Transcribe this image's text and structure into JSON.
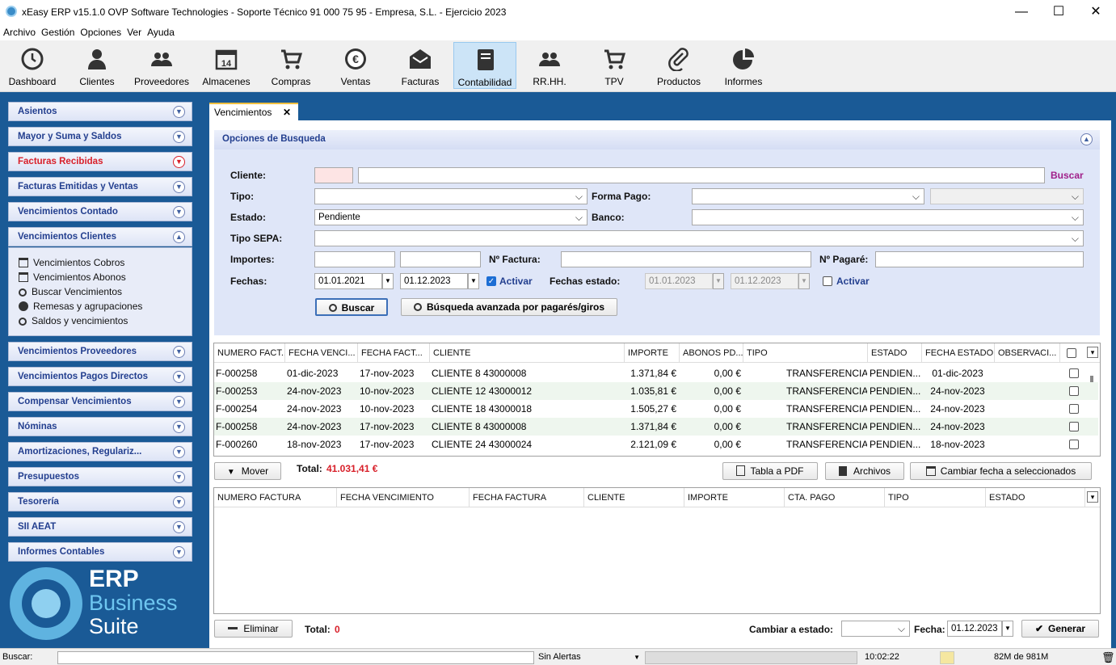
{
  "window": {
    "title": "xEasy ERP v15.1.0 OVP Software Technologies - Soporte Técnico 91 000 75 95 - Empresa, S.L. - Ejercicio 2023",
    "minimize": "—",
    "maximize": "☐",
    "close": "✕"
  },
  "menu": [
    "Archivo",
    "Gestión",
    "Opciones",
    "Ver",
    "Ayuda"
  ],
  "toolbar": [
    {
      "label": "Dashboard",
      "icon": "clock-icon"
    },
    {
      "label": "Clientes",
      "icon": "person-icon"
    },
    {
      "label": "Proveedores",
      "icon": "group-icon"
    },
    {
      "label": "Almacenes",
      "icon": "calendar-icon"
    },
    {
      "label": "Compras",
      "icon": "cart-icon"
    },
    {
      "label": "Ventas",
      "icon": "euro-icon"
    },
    {
      "label": "Facturas",
      "icon": "envelope-icon"
    },
    {
      "label": "Contabilidad",
      "icon": "book-icon",
      "active": true
    },
    {
      "label": "RR.HH.",
      "icon": "group-icon"
    },
    {
      "label": "TPV",
      "icon": "cart-icon"
    },
    {
      "label": "Productos",
      "icon": "paperclip-icon"
    },
    {
      "label": "Informes",
      "icon": "piechart-icon"
    }
  ],
  "sidebar": {
    "sections": [
      "Asientos",
      "Mayor y Suma y Saldos",
      "Facturas Recibidas",
      "Facturas Emitidas y Ventas",
      "Vencimientos Contado",
      "Vencimientos Clientes",
      "Vencimientos Proveedores",
      "Vencimientos Pagos Directos",
      "Compensar Vencimientos",
      "Nóminas",
      "Amortizaciones, Regulariz...",
      "Presupuestos",
      "Tesorería",
      "SII AEAT",
      "Informes Contables"
    ],
    "subitems": [
      "Vencimientos Cobros",
      "Vencimientos Abonos",
      "Buscar Vencimientos",
      "Remesas y agrupaciones",
      "Saldos y vencimientos"
    ],
    "logo": {
      "l1": "ERP",
      "l2": "Business",
      "l3": "Suite"
    }
  },
  "tab": {
    "label": "Vencimientos",
    "close": "✕"
  },
  "search": {
    "header": "Opciones de Busqueda",
    "cliente_label": "Cliente:",
    "buscar_link": "Buscar",
    "tipo_label": "Tipo:",
    "forma_pago_label": "Forma Pago:",
    "estado_label": "Estado:",
    "estado_value": "Pendiente",
    "banco_label": "Banco:",
    "tipo_sepa_label": "Tipo SEPA:",
    "importes_label": "Importes:",
    "nfactura_label": "Nº Factura:",
    "npagare_label": "Nº Pagaré:",
    "fechas_label": "Fechas:",
    "fecha_desde": "01.01.2021",
    "fecha_hasta": "01.12.2023",
    "activar": "Activar",
    "fechas_estado_label": "Fechas estado:",
    "fe_desde": "01.01.2023",
    "fe_hasta": "01.12.2023",
    "activar2": "Activar",
    "buscar_btn": "Buscar",
    "avanzada_btn": "Búsqueda avanzada por pagarés/giros"
  },
  "grid1": {
    "headers": [
      "NUMERO FACT...",
      "FECHA VENCI...",
      "FECHA FACT...",
      "CLIENTE",
      "IMPORTE",
      "ABONOS PD...",
      "TIPO",
      "ESTADO",
      "FECHA ESTADO",
      "OBSERVACI..."
    ],
    "rows": [
      [
        "F-000258",
        "01-dic-2023",
        "17-nov-2023",
        "CLIENTE 8 43000008",
        "1.371,84 €",
        "0,00 €",
        "TRANSFERENCIA",
        "PENDIEN...",
        "01-dic-2023"
      ],
      [
        "F-000253",
        "24-nov-2023",
        "10-nov-2023",
        "CLIENTE 12 43000012",
        "1.035,81 €",
        "0,00 €",
        "TRANSFERENCIA",
        "PENDIEN...",
        "24-nov-2023"
      ],
      [
        "F-000254",
        "24-nov-2023",
        "10-nov-2023",
        "CLIENTE 18 43000018",
        "1.505,27 €",
        "0,00 €",
        "TRANSFERENCIA",
        "PENDIEN...",
        "24-nov-2023"
      ],
      [
        "F-000258",
        "24-nov-2023",
        "17-nov-2023",
        "CLIENTE 8 43000008",
        "1.371,84 €",
        "0,00 €",
        "TRANSFERENCIA",
        "PENDIEN...",
        "24-nov-2023"
      ],
      [
        "F-000260",
        "18-nov-2023",
        "17-nov-2023",
        "CLIENTE 24 43000024",
        "2.121,09 €",
        "0,00 €",
        "TRANSFERENCIA",
        "PENDIEN...",
        "18-nov-2023"
      ]
    ]
  },
  "actions1": {
    "mover": "Mover",
    "total_label": "Total:",
    "total_value": "41.031,41 €",
    "pdf": "Tabla a PDF",
    "archivos": "Archivos",
    "cambiar_fecha": "Cambiar fecha a seleccionados"
  },
  "grid2": {
    "headers": [
      "NUMERO FACTURA",
      "FECHA VENCIMIENTO",
      "FECHA FACTURA",
      "CLIENTE",
      "IMPORTE",
      "CTA. PAGO",
      "TIPO",
      "ESTADO"
    ]
  },
  "actions2": {
    "eliminar": "Eliminar",
    "total_label": "Total:",
    "total_value": "0",
    "cambiar_estado": "Cambiar a estado:",
    "fecha_label": "Fecha:",
    "fecha_value": "01.12.2023",
    "generar": "Generar"
  },
  "statusbar": {
    "buscar": "Buscar:",
    "alertas": "Sin Alertas",
    "time": "10:02:22",
    "mem": "82M de 981M"
  }
}
